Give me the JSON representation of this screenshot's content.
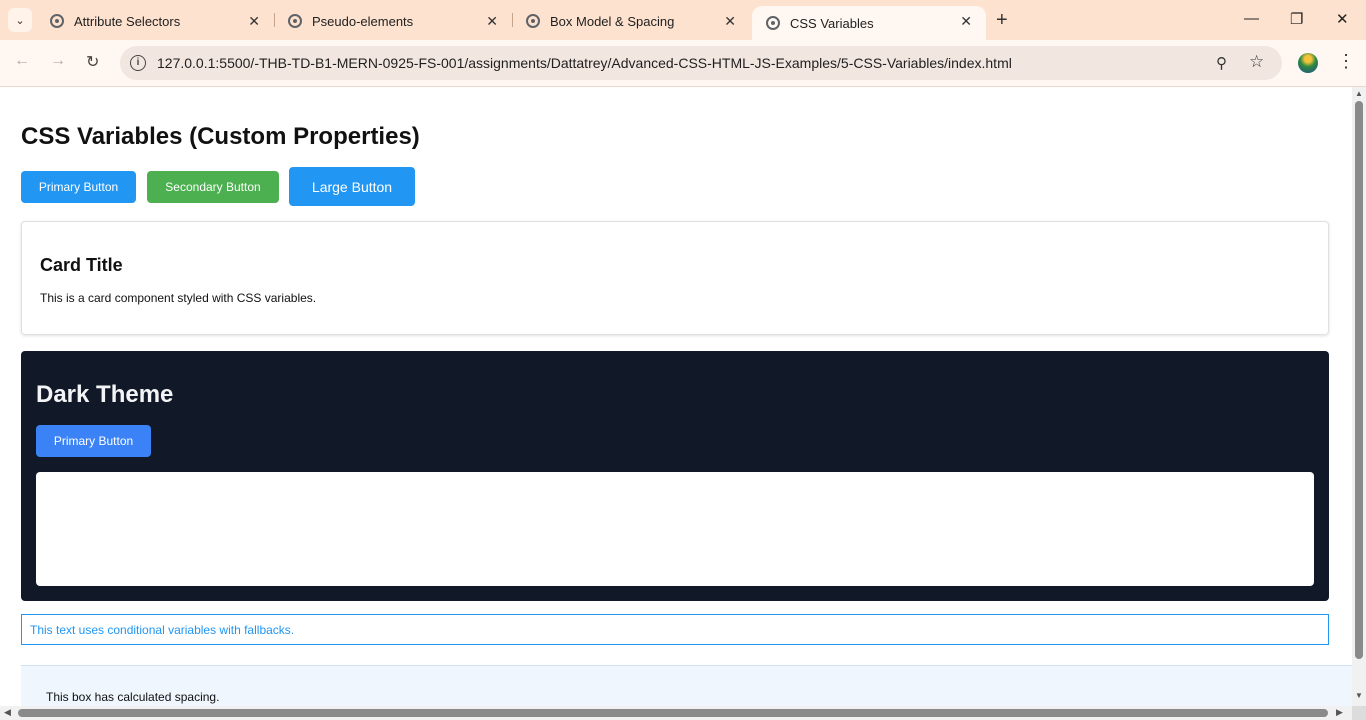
{
  "browser": {
    "tabs": [
      {
        "title": "Attribute Selectors",
        "active": false
      },
      {
        "title": "Pseudo-elements",
        "active": false
      },
      {
        "title": "Box Model & Spacing",
        "active": false
      },
      {
        "title": "CSS Variables",
        "active": true
      }
    ],
    "url_host": "127.0.0.1",
    "url_path": ":5500/-THB-TD-B1-MERN-0925-FS-001/assignments/Dattatrey/Advanced-CSS-HTML-JS-Examples/5-CSS-Variables/index.html",
    "icons": {
      "tab_search": "chevron-down-icon",
      "new_tab": "plus-icon",
      "minimize": "minimize-icon",
      "restore": "restore-icon",
      "close": "close-icon",
      "back": "back-arrow-icon",
      "forward": "forward-arrow-icon",
      "reload": "reload-icon",
      "site_info": "info-icon",
      "zoom": "zoom-icon",
      "bookmark": "star-icon",
      "menu": "more-vert-icon"
    }
  },
  "page": {
    "heading": "CSS Variables (Custom Properties)",
    "buttons": {
      "primary": "Primary Button",
      "secondary": "Secondary Button",
      "large": "Large Button"
    },
    "card": {
      "title": "Card Title",
      "text": "This is a card component styled with CSS variables."
    },
    "dark_section": {
      "title": "Dark Theme",
      "button": "Primary Button"
    },
    "conditional_text": "This text uses conditional variables with fallbacks.",
    "calc_text": "This box has calculated spacing."
  },
  "colors": {
    "primary": "#2196f3",
    "secondary": "#4caf50",
    "dark_bg": "#111827",
    "dark_primary": "#3b82f6",
    "tabbar_bg": "#fde2cf"
  }
}
